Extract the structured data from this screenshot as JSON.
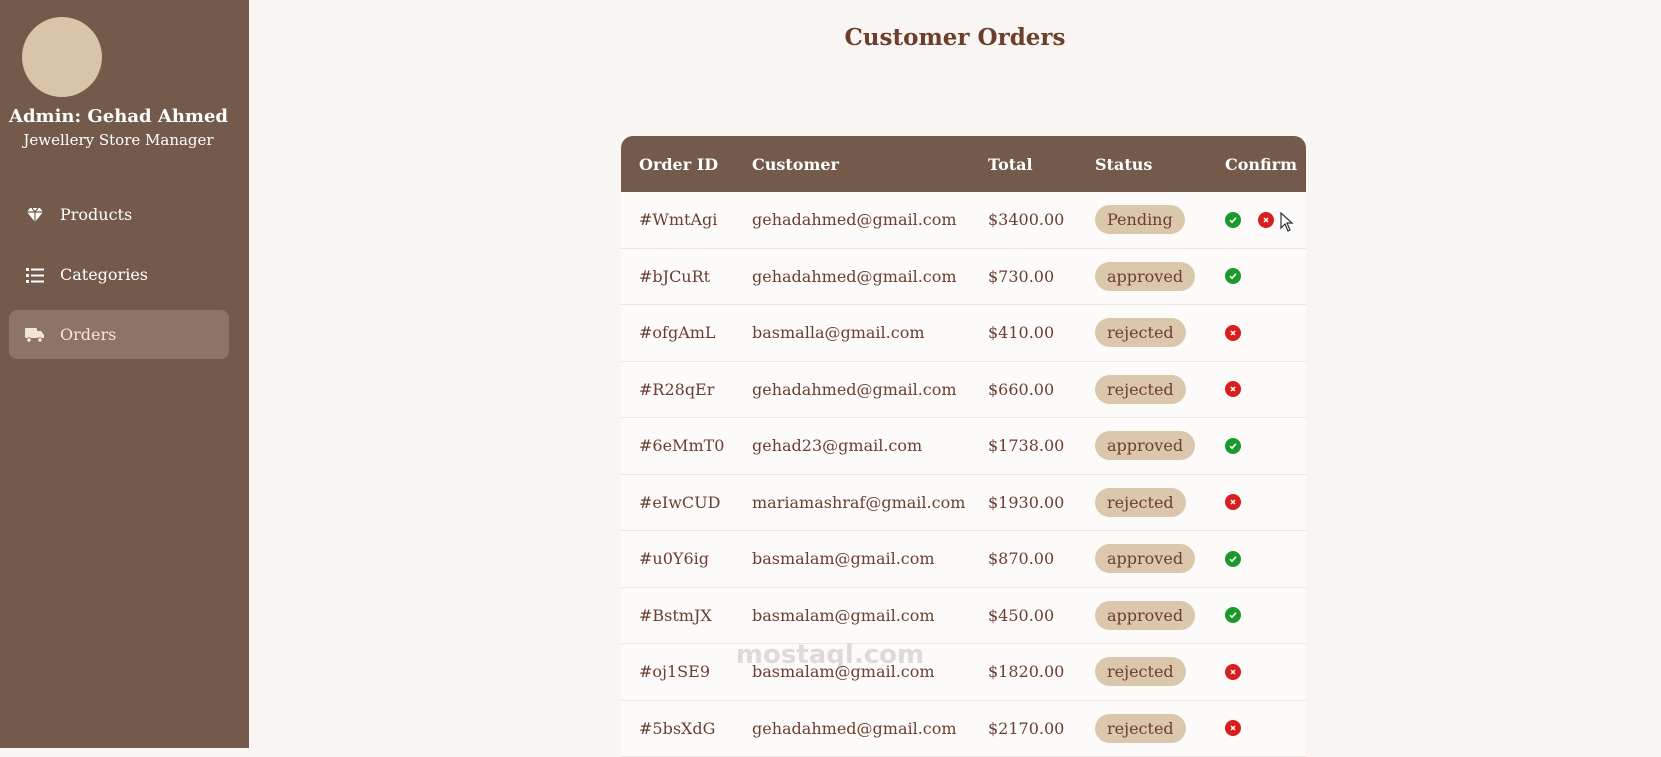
{
  "sidebar": {
    "admin_name": "Admin: Gehad Ahmed",
    "admin_role": "Jewellery Store Manager",
    "items": [
      {
        "label": "Products",
        "icon": "gem-icon"
      },
      {
        "label": "Categories",
        "icon": "list-icon"
      },
      {
        "label": "Orders",
        "icon": "truck-icon",
        "active": true
      }
    ]
  },
  "page": {
    "title": "Customer Orders"
  },
  "table": {
    "headers": [
      "Order ID",
      "Customer",
      "Total",
      "Status",
      "Confirm"
    ],
    "rows": [
      {
        "id": "#WmtAgi",
        "customer": "gehadahmed@gmail.com",
        "total": "$3400.00",
        "status": "Pending",
        "actions": [
          "approve",
          "reject"
        ]
      },
      {
        "id": "#bJCuRt",
        "customer": "gehadahmed@gmail.com",
        "total": "$730.00",
        "status": "approved",
        "actions": [
          "approved"
        ]
      },
      {
        "id": "#ofgAmL",
        "customer": "basmalla@gmail.com",
        "total": "$410.00",
        "status": "rejected",
        "actions": [
          "rejected"
        ]
      },
      {
        "id": "#R28qEr",
        "customer": "gehadahmed@gmail.com",
        "total": "$660.00",
        "status": "rejected",
        "actions": [
          "rejected"
        ]
      },
      {
        "id": "#6eMmT0",
        "customer": "gehad23@gmail.com",
        "total": "$1738.00",
        "status": "approved",
        "actions": [
          "approved"
        ]
      },
      {
        "id": "#eIwCUD",
        "customer": "mariamashraf@gmail.com",
        "total": "$1930.00",
        "status": "rejected",
        "actions": [
          "rejected"
        ]
      },
      {
        "id": "#u0Y6ig",
        "customer": "basmalam@gmail.com",
        "total": "$870.00",
        "status": "approved",
        "actions": [
          "approved"
        ]
      },
      {
        "id": "#BstmJX",
        "customer": "basmalam@gmail.com",
        "total": "$450.00",
        "status": "approved",
        "actions": [
          "approved"
        ]
      },
      {
        "id": "#oj1SE9",
        "customer": "basmalam@gmail.com",
        "total": "$1820.00",
        "status": "rejected",
        "actions": [
          "rejected"
        ]
      },
      {
        "id": "#5bsXdG",
        "customer": "gehadahmed@gmail.com",
        "total": "$2170.00",
        "status": "rejected",
        "actions": [
          "rejected"
        ]
      }
    ]
  },
  "watermark": "mostaql.com",
  "colors": {
    "sidebar_bg": "#735a4b",
    "active_item_bg": "#8c7566",
    "accent_text": "#6b3e2e",
    "badge_bg": "#dbc7ac",
    "approve": "#1a9a2a",
    "reject": "#d81f1f"
  }
}
